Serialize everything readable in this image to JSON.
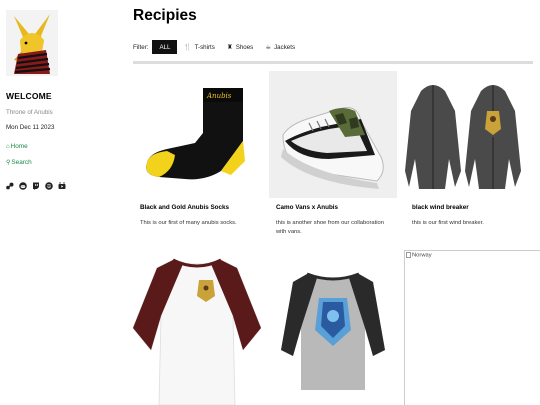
{
  "sidebar": {
    "welcome": "WELCOME",
    "subtitle": "Throne of Anubis",
    "date": "Mon Dec 11 2023",
    "nav": [
      {
        "label": "Home",
        "icon": "home-icon"
      },
      {
        "label": "Search",
        "icon": "search-icon"
      }
    ],
    "social": [
      "steam-icon",
      "reddit-icon",
      "twitch-icon",
      "spotify-icon",
      "youtube-icon"
    ]
  },
  "main": {
    "title": "Recipies",
    "filter_label": "Filter:",
    "filters": [
      {
        "label": "ALL",
        "active": true
      },
      {
        "label": "T-shirts",
        "icon": "utensils-icon"
      },
      {
        "label": "Shoes",
        "icon": "chess-icon"
      },
      {
        "label": "Jackets",
        "icon": "coffee-icon"
      }
    ],
    "products": [
      {
        "name": "Black and Gold Anubis Socks",
        "description": "This is our first of many anubis socks.",
        "label_on_item": "Anubis"
      },
      {
        "name": "Camo Vans x Anubis",
        "description": "this is another shoe from our collaboration with vans."
      },
      {
        "name": "black wind breaker",
        "description": "this is our first wind breaker."
      },
      {
        "name": "",
        "description": ""
      },
      {
        "name": "",
        "description": ""
      },
      {
        "name": "",
        "description": "",
        "alt": "Norway"
      }
    ]
  },
  "colors": {
    "accent": "#1a8a4a",
    "active_filter_bg": "#111111",
    "divider": "#dddddd"
  }
}
